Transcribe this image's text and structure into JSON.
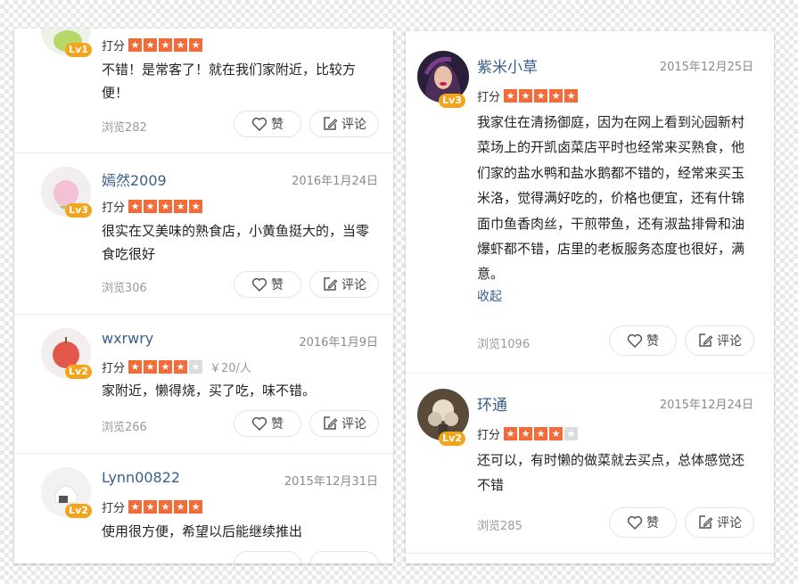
{
  "colors": {
    "star_on": "#f26b38",
    "star_off": "#dcdcdc",
    "level_badge": "#f2a51c",
    "username": "#3a5e8c"
  },
  "labels": {
    "rating": "打分",
    "like": "赞",
    "comment": "评论",
    "collapse": "收起"
  },
  "left_reviews": [
    {
      "name": "",
      "date": "",
      "level": "Lv1",
      "stars": 5,
      "price": "",
      "content": "不错！是常客了！就在我们家附近，比较方便！",
      "views": "浏览282"
    },
    {
      "name": "嫣然2009",
      "date": "2016年1月24日",
      "level": "Lv3",
      "stars": 5,
      "price": "",
      "content": "很实在又美味的熟食店，小黄鱼挺大的，当零食吃很好",
      "views": "浏览306"
    },
    {
      "name": "wxrwry",
      "date": "2016年1月9日",
      "level": "Lv2",
      "stars": 4,
      "price": "￥20/人",
      "content": "家附近，懒得烧，买了吃，味不错。",
      "views": "浏览266"
    },
    {
      "name": "Lynn00822",
      "date": "2015年12月31日",
      "level": "Lv2",
      "stars": 5,
      "price": "",
      "content": "使用很方便，希望以后能继续推出",
      "views": ""
    }
  ],
  "right_reviews": [
    {
      "name": "紫米小草",
      "date": "2015年12月25日",
      "level": "Lv3",
      "stars": 5,
      "content": "我家住在清扬御庭，因为在网上看到沁园新村菜场上的开凯卤菜店平时也经常来买熟食，他们家的盐水鸭和盐水鹅都不错的，经常来买玉米洛，觉得满好吃的，价格也便宜，还有什锦面巾鱼香肉丝，干煎带鱼，还有淑盐排骨和油爆虾都不错，店里的老板服务态度也很好，满意。",
      "views": "浏览1096"
    },
    {
      "name": "环通",
      "date": "2015年12月24日",
      "level": "Lv2",
      "stars": 4,
      "content": "还可以，有时懒的做菜就去买点，总体感觉还不错",
      "views": "浏览285"
    }
  ]
}
